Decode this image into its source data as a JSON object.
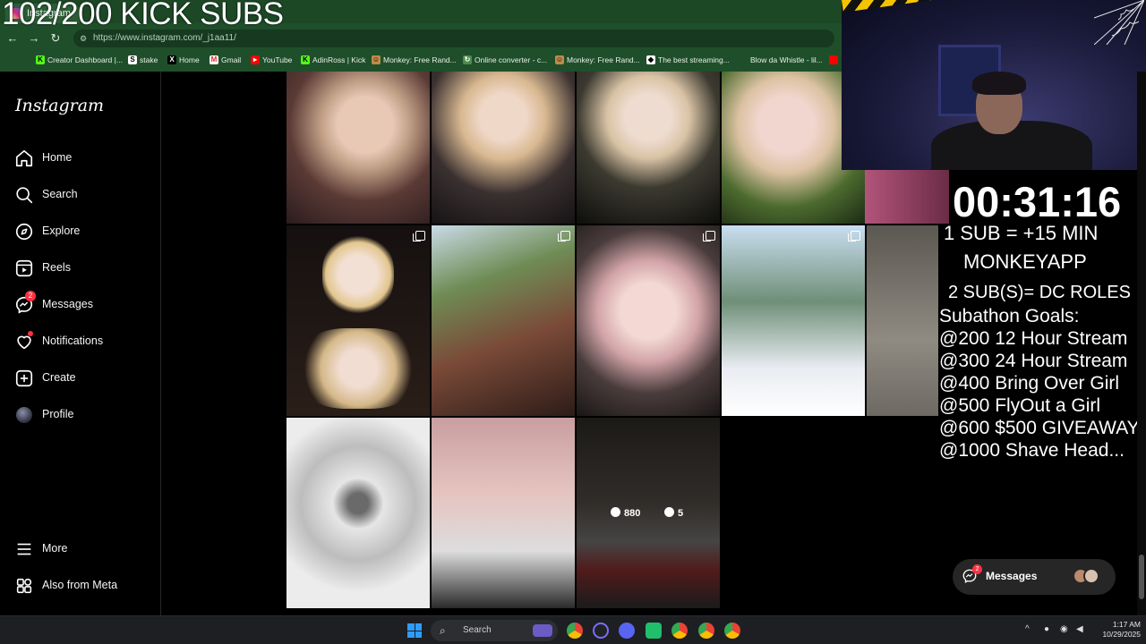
{
  "overlay_top": {
    "sub_counter": "102/200 KICK SUBS"
  },
  "browser": {
    "tab_title": "Instagram",
    "url": "https://www.instagram.com/_j1aa11/",
    "bookmarks": [
      {
        "label": "Creator Dashboard |...",
        "icon": "kick-icon"
      },
      {
        "label": "stake",
        "icon": "stake-icon"
      },
      {
        "label": "Home",
        "icon": "x-icon"
      },
      {
        "label": "Gmail",
        "icon": "gmail-icon"
      },
      {
        "label": "YouTube",
        "icon": "youtube-icon"
      },
      {
        "label": "AdinRoss | Kick",
        "icon": "kick-icon"
      },
      {
        "label": "Monkey: Free Rand...",
        "icon": "monkey-icon"
      },
      {
        "label": "Online converter - c...",
        "icon": "converter-icon"
      },
      {
        "label": "Monkey: Free Rand...",
        "icon": "monkey-icon"
      },
      {
        "label": "The best streaming...",
        "icon": "streaming-icon"
      },
      {
        "label": "Blow da Whistle - lil...",
        "icon": "music-icon"
      }
    ]
  },
  "sidebar": {
    "logo": "Instagram",
    "items": [
      {
        "label": "Home",
        "icon": "home-icon"
      },
      {
        "label": "Search",
        "icon": "search-icon"
      },
      {
        "label": "Explore",
        "icon": "compass-icon"
      },
      {
        "label": "Reels",
        "icon": "reels-icon"
      },
      {
        "label": "Messages",
        "icon": "messenger-icon",
        "badge": "2"
      },
      {
        "label": "Notifications",
        "icon": "heart-icon"
      },
      {
        "label": "Create",
        "icon": "plus-square-icon"
      },
      {
        "label": "Profile",
        "icon": "avatar"
      }
    ],
    "more": "More",
    "also_from_meta": "Also from Meta"
  },
  "grid": {
    "hover_post": {
      "likes": "880",
      "comments": "5"
    }
  },
  "stream_overlay": {
    "timer": "00:31:16",
    "lines": [
      "1 SUB = +15 MIN",
      "MONKEYAPP",
      "2 SUB(S)= DC ROLES",
      "Subathon Goals:",
      "@200 12 Hour Stream",
      "@300 24 Hour Stream",
      "@400 Bring Over Girl",
      "@500 FlyOut a Girl",
      "@600 $500 GIVEAWAY",
      "@1000 Shave Head..."
    ]
  },
  "messages_float": {
    "label": "Messages",
    "badge": "2"
  },
  "taskbar": {
    "search_placeholder": "Search",
    "time": "1:17 AM",
    "date": "10/29/2025"
  },
  "colors": {
    "chrome_green": "#1f4f2a",
    "badge_red": "#ff3040",
    "instagram_bg": "#000000"
  }
}
